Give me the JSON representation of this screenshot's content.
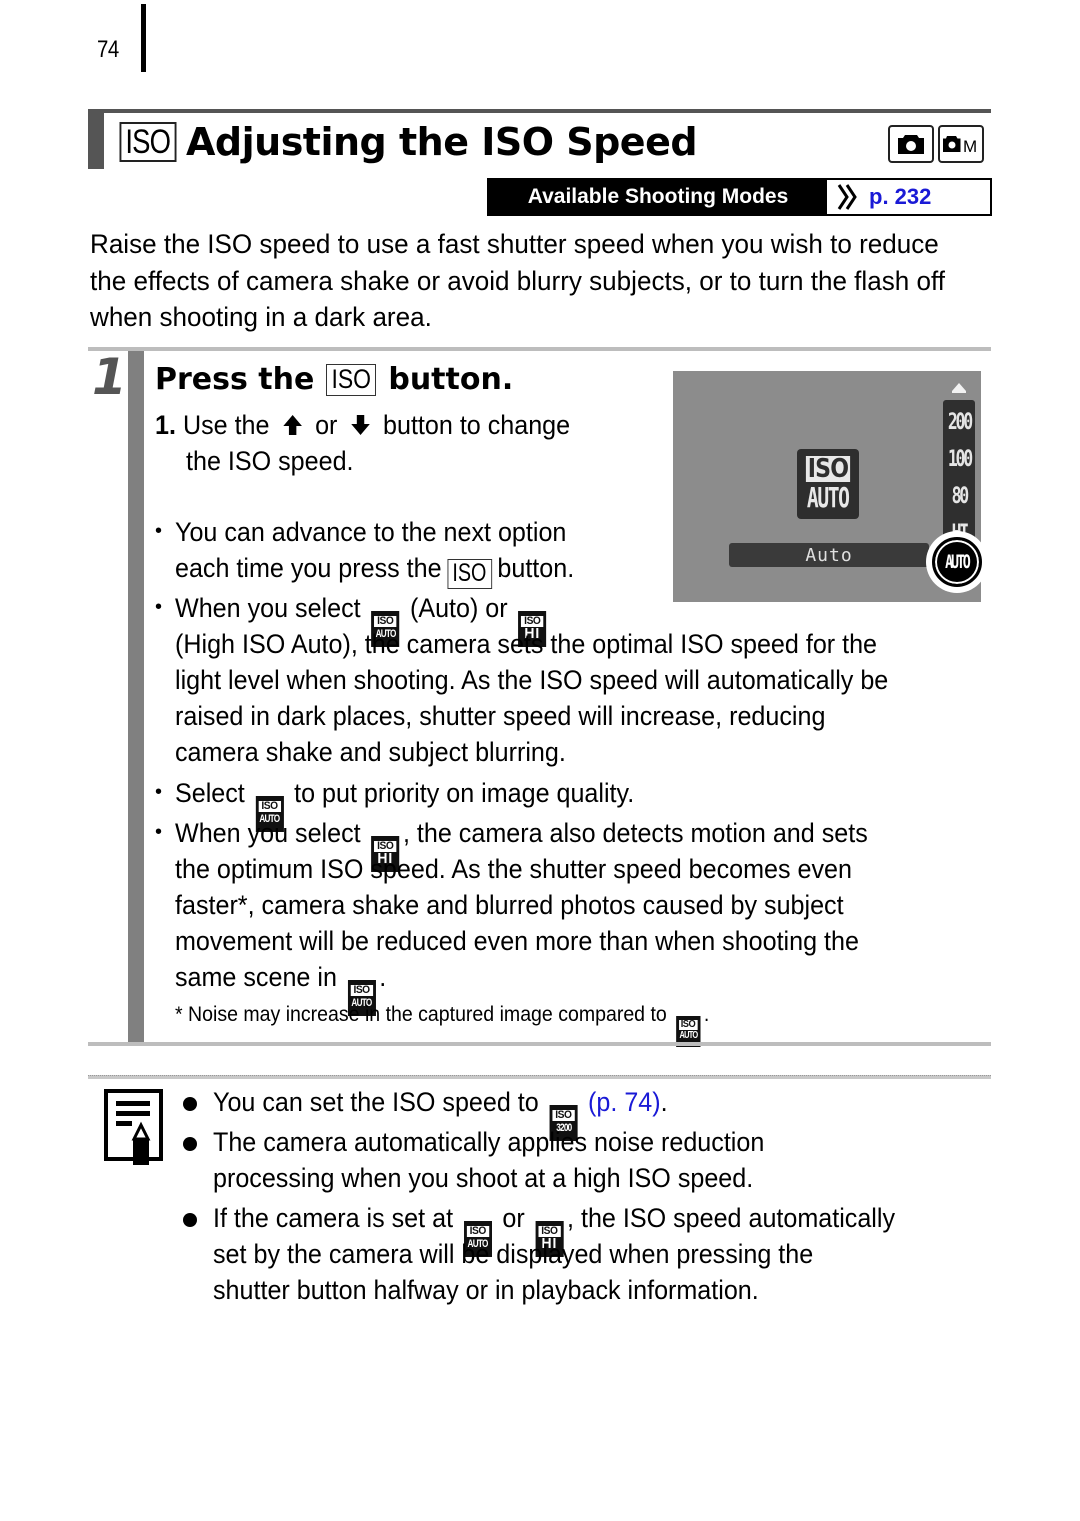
{
  "page": {
    "number": "74"
  },
  "header": {
    "title_icon": "ISO",
    "title": "Adjusting the ISO Speed",
    "mode_icons": [
      {
        "name": "camera-auto-mode-icon"
      },
      {
        "name": "camera-manual-mode-icon",
        "letter": "M"
      }
    ],
    "modes_banner": {
      "label": "Available Shooting Modes",
      "link_text": "p. 232",
      "link_color": "#1a1ad6"
    }
  },
  "intro": "Raise the ISO speed to use a fast shutter speed when you wish to reduce the effects of camera shake or avoid blurry subjects, or to turn the flash off when shooting in a dark area.",
  "step": {
    "number": "1",
    "heading_prefix": "Press the",
    "heading_icon": "ISO",
    "heading_suffix": "button.",
    "substep_num": "1.",
    "substep_a": "Use the",
    "substep_or": "or",
    "substep_b": "button to change",
    "substep_line2": "the ISO speed.",
    "bullets": {
      "b1_line1": "You can advance to the next option",
      "b1_line2a": "each time you press the",
      "b1_icon": "ISO",
      "b1_line2b": "button.",
      "b2_a": "When you select",
      "b2_b": "(Auto) or",
      "b2_cont": [
        "(High ISO Auto), the camera sets the optimal ISO speed for the",
        "light level when shooting. As the ISO speed will automatically be",
        "raised in dark places, shutter speed will increase, reducing",
        "camera shake and subject blurring."
      ],
      "b3_a": "Select",
      "b3_b": "to put priority on image quality.",
      "b4_a": "When you select",
      "b4_b": ", the camera also detects motion and sets",
      "b4_cont": [
        "the optimum ISO speed. As the shutter speed becomes even",
        "faster*, camera shake and blurred photos caused by subject",
        "movement will be reduced even more than when shooting the"
      ],
      "b4_last_a": "same scene in",
      "b4_last_b": "."
    },
    "footnote_a": "*  Noise may increase in the captured image compared to",
    "footnote_b": "."
  },
  "icons": {
    "iso_top": "ISO",
    "auto": "AUTO",
    "hi": "HI",
    "iso3200": "3200"
  },
  "lcd": {
    "center_top": "ISO",
    "center_bottom": "AUTO",
    "selected_label": "Auto",
    "scale": [
      "200",
      "100",
      "80",
      "HI"
    ],
    "dial_value": "AUTO"
  },
  "notes": {
    "n1_a": "You can set the ISO speed to",
    "n1_link": "(p. 74)",
    "n1_end": ".",
    "n2": [
      "The camera automatically applies noise reduction",
      "processing when you shoot at a high ISO speed."
    ],
    "n3_a": "If the camera is set at",
    "n3_or": "or",
    "n3_b": ", the ISO speed automatically",
    "n3_cont": [
      "set by the camera will be displayed when pressing the",
      "shutter button halfway or in playback information."
    ]
  }
}
